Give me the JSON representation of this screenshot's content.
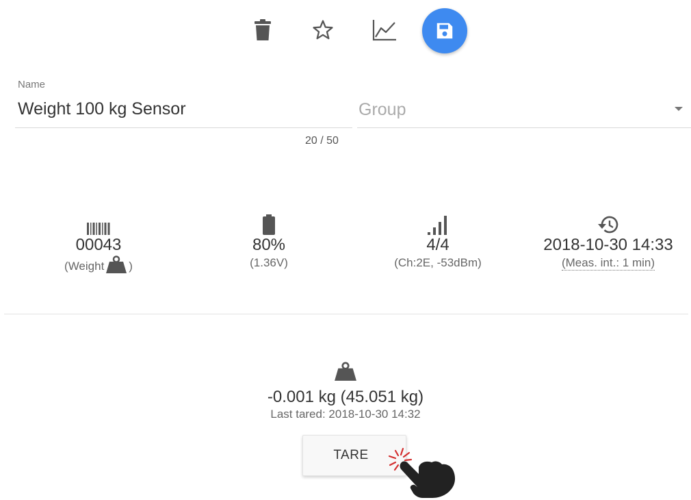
{
  "toolbar": {
    "icons": [
      "delete-icon",
      "star-icon",
      "chart-icon",
      "save-icon"
    ],
    "save_color": "#3e8af0"
  },
  "form": {
    "name_label": "Name",
    "name_value": "Weight 100 kg Sensor",
    "name_counter": "20 / 50",
    "group_placeholder": "Group"
  },
  "stats": {
    "id": {
      "icon": "barcode-icon",
      "value": "00043",
      "sub_prefix": "(Weight",
      "sub_suffix": ")"
    },
    "battery": {
      "icon": "battery-icon",
      "value": "80%",
      "sub": "(1.36V)"
    },
    "signal": {
      "icon": "signal-icon",
      "value": "4/4",
      "sub": "(Ch:2E, -53dBm)"
    },
    "history": {
      "icon": "history-icon",
      "value": "2018-10-30 14:33",
      "sub": "(Meas. int.: 1 min)"
    }
  },
  "weight": {
    "icon": "weight-icon",
    "value": "-0.001 kg (45.051 kg)",
    "last_tared": "Last tared: 2018-10-30 14:32"
  },
  "tare_button": {
    "label": "TARE"
  },
  "cursor": {
    "icon": "pointer-hand-icon",
    "click_color": "#d32f2f"
  }
}
